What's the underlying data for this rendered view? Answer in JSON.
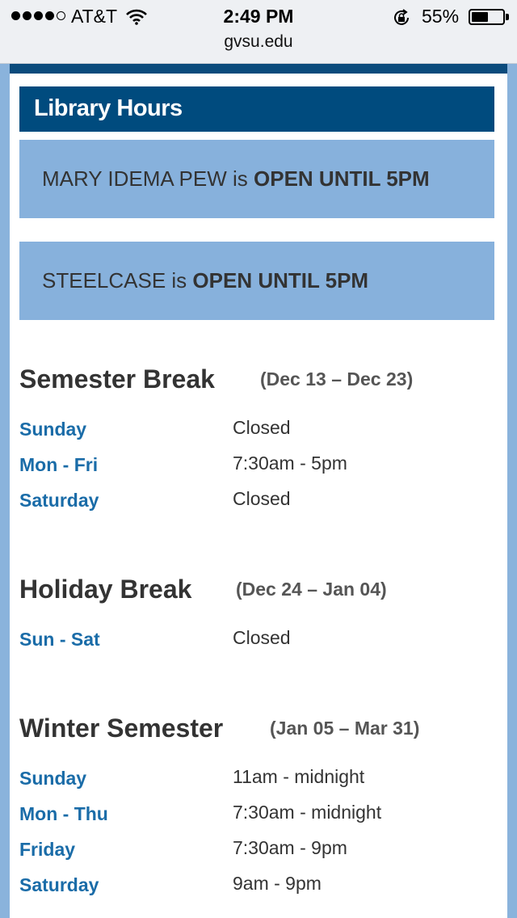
{
  "status_bar": {
    "carrier": "AT&T",
    "time": "2:49 PM",
    "battery_percent": "55%",
    "battery_level": 0.55,
    "signal_dots_filled": 4,
    "signal_dots_total": 5
  },
  "url_bar": {
    "url": "gvsu.edu"
  },
  "library_hours": {
    "title": "Library Hours",
    "locations": [
      {
        "name": "MARY IDEMA PEW",
        "connector": "is",
        "status": "OPEN UNTIL 5PM"
      },
      {
        "name": "STEELCASE",
        "connector": "is",
        "status": "OPEN UNTIL 5PM"
      }
    ]
  },
  "schedule": [
    {
      "title": "Semester Break",
      "range": "(Dec 13 – Dec 23)",
      "rows": [
        {
          "day": "Sunday",
          "hours": "Closed"
        },
        {
          "day": "Mon - Fri",
          "hours": "7:30am - 5pm"
        },
        {
          "day": "Saturday",
          "hours": "Closed"
        }
      ]
    },
    {
      "title": "Holiday Break",
      "range": "(Dec 24 – Jan 04)",
      "rows": [
        {
          "day": "Sun - Sat",
          "hours": "Closed"
        }
      ]
    },
    {
      "title": "Winter Semester",
      "range": "(Jan 05 – Mar 31)",
      "rows": [
        {
          "day": "Sunday",
          "hours": "11am - midnight"
        },
        {
          "day": "Mon - Thu",
          "hours": "7:30am - midnight"
        },
        {
          "day": "Friday",
          "hours": "7:30am - 9pm"
        },
        {
          "day": "Saturday",
          "hours": "9am - 9pm"
        }
      ]
    }
  ],
  "colors": {
    "header_bg": "#004b7e",
    "status_box_bg": "#87b1dc",
    "day_label": "#1a6ca8",
    "frame": "#8ab3dc"
  }
}
